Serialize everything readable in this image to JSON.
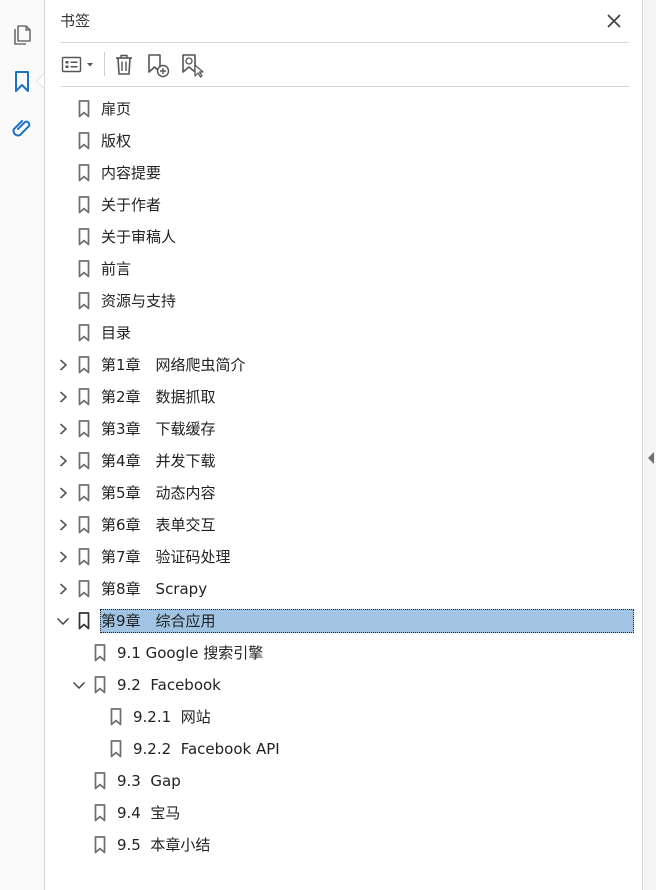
{
  "panel": {
    "title": "书签"
  },
  "rail": {
    "icons": [
      "pages-icon",
      "bookmark-icon",
      "attachment-icon"
    ],
    "active": "bookmark-icon"
  },
  "toolbar": {
    "buttons": [
      "options-menu-icon",
      "delete-bookmark-icon",
      "new-bookmark-icon",
      "find-bookmark-icon"
    ]
  },
  "colors": {
    "accent": "#1e72c6",
    "selection": "#a1c4e2",
    "icon": "#6e6e6e"
  },
  "bookmarks": [
    {
      "label": "扉页",
      "level": 0,
      "expander": "none"
    },
    {
      "label": "版权",
      "level": 0,
      "expander": "none"
    },
    {
      "label": "内容提要",
      "level": 0,
      "expander": "none"
    },
    {
      "label": "关于作者",
      "level": 0,
      "expander": "none"
    },
    {
      "label": "关于审稿人",
      "level": 0,
      "expander": "none"
    },
    {
      "label": "前言",
      "level": 0,
      "expander": "none"
    },
    {
      "label": "资源与支持",
      "level": 0,
      "expander": "none"
    },
    {
      "label": "目录",
      "level": 0,
      "expander": "none"
    },
    {
      "label": "第1章　网络爬虫简介",
      "level": 0,
      "expander": "collapsed"
    },
    {
      "label": "第2章　数据抓取",
      "level": 0,
      "expander": "collapsed"
    },
    {
      "label": "第3章　下载缓存",
      "level": 0,
      "expander": "collapsed"
    },
    {
      "label": "第4章　并发下载",
      "level": 0,
      "expander": "collapsed"
    },
    {
      "label": "第5章　动态内容",
      "level": 0,
      "expander": "collapsed"
    },
    {
      "label": "第6章　表单交互",
      "level": 0,
      "expander": "collapsed"
    },
    {
      "label": "第7章　验证码处理",
      "level": 0,
      "expander": "collapsed"
    },
    {
      "label": "第8章　Scrapy",
      "level": 0,
      "expander": "collapsed"
    },
    {
      "label": "第9章　综合应用",
      "level": 0,
      "expander": "expanded",
      "selected": true
    },
    {
      "label": "9.1 Google 搜索引擎",
      "level": 1,
      "expander": "none"
    },
    {
      "label": "9.2  Facebook",
      "level": 1,
      "expander": "expanded"
    },
    {
      "label": "9.2.1  网站",
      "level": 2,
      "expander": "none"
    },
    {
      "label": "9.2.2  Facebook API",
      "level": 2,
      "expander": "none"
    },
    {
      "label": "9.3  Gap",
      "level": 1,
      "expander": "none"
    },
    {
      "label": "9.4  宝马",
      "level": 1,
      "expander": "none"
    },
    {
      "label": "9.5  本章小结",
      "level": 1,
      "expander": "none"
    }
  ]
}
